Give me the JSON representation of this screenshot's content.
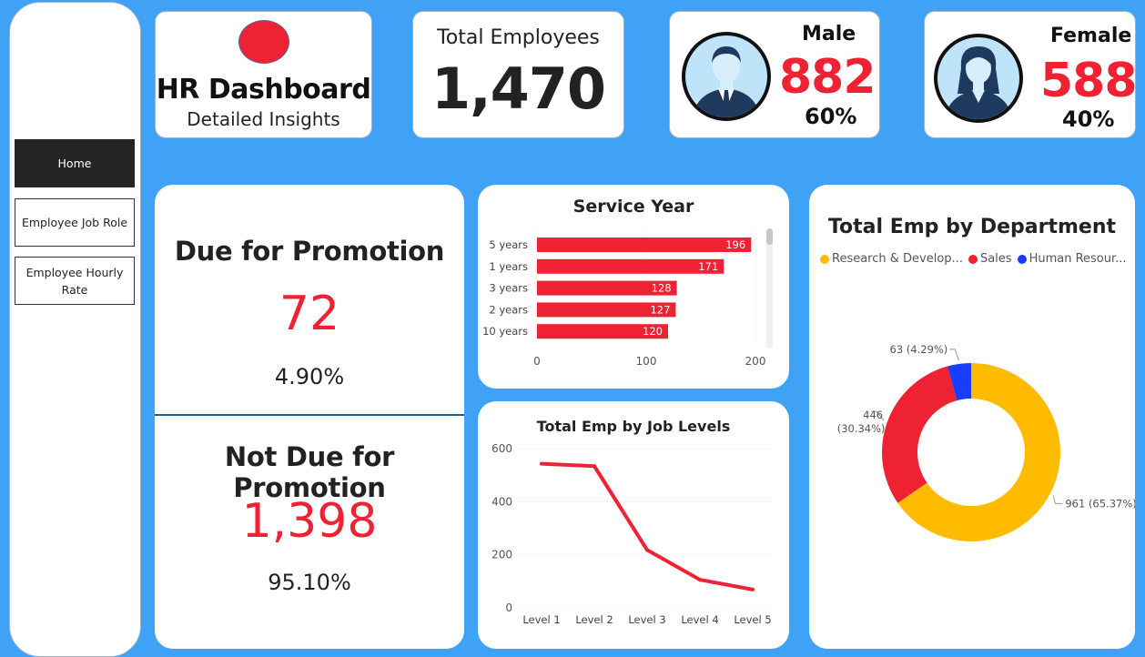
{
  "nav": {
    "items": [
      {
        "label": "Home",
        "active": true
      },
      {
        "label": "Employee Job Role",
        "active": false
      },
      {
        "label": "Employee Hourly Rate",
        "active": false
      }
    ]
  },
  "header": {
    "title": "HR Dashboard",
    "subtitle": "Detailed Insights"
  },
  "kpis": {
    "total": {
      "label": "Total Employees",
      "value": "1,470"
    },
    "male": {
      "label": "Male",
      "value": "882",
      "pct": "60%",
      "icon": "male-avatar-icon"
    },
    "female": {
      "label": "Female",
      "value": "588",
      "pct": "40%",
      "icon": "female-avatar-icon"
    }
  },
  "promotion": {
    "due": {
      "label": "Due for Promotion",
      "value": "72",
      "pct": "4.90%"
    },
    "not_due": {
      "label": "Not Due for Promotion",
      "value": "1,398",
      "pct": "95.10%"
    }
  },
  "colors": {
    "accent_red": "#ee2233",
    "background": "#3fa2f6",
    "yellow": "#ffbb00",
    "blue": "#1a3cff"
  },
  "chart_data": [
    {
      "type": "bar",
      "orientation": "horizontal",
      "title": "Service Year",
      "categories": [
        "5 years",
        "1 years",
        "3 years",
        "2 years",
        "10 years"
      ],
      "values": [
        196,
        171,
        128,
        127,
        120
      ],
      "xticks": [
        "0",
        "100",
        "200"
      ],
      "xlim": [
        0,
        200
      ]
    },
    {
      "type": "line",
      "title": "Total Emp by Job Levels",
      "categories": [
        "Level 1",
        "Level 2",
        "Level 3",
        "Level 4",
        "Level 5"
      ],
      "values": [
        543,
        534,
        218,
        106,
        69
      ],
      "yticks": [
        "0",
        "200",
        "400",
        "600"
      ],
      "ylim": [
        0,
        600
      ]
    },
    {
      "type": "pie",
      "title": "Total Emp by Department",
      "legend": [
        "Research & Develop...",
        "Sales",
        "Human Resour..."
      ],
      "values": [
        961,
        446,
        63
      ],
      "labels": [
        "961 (65.37%)",
        "446 (30.34%)",
        "63 (4.29%)"
      ],
      "colors": [
        "#ffbb00",
        "#ee2233",
        "#1a3cff"
      ]
    }
  ]
}
